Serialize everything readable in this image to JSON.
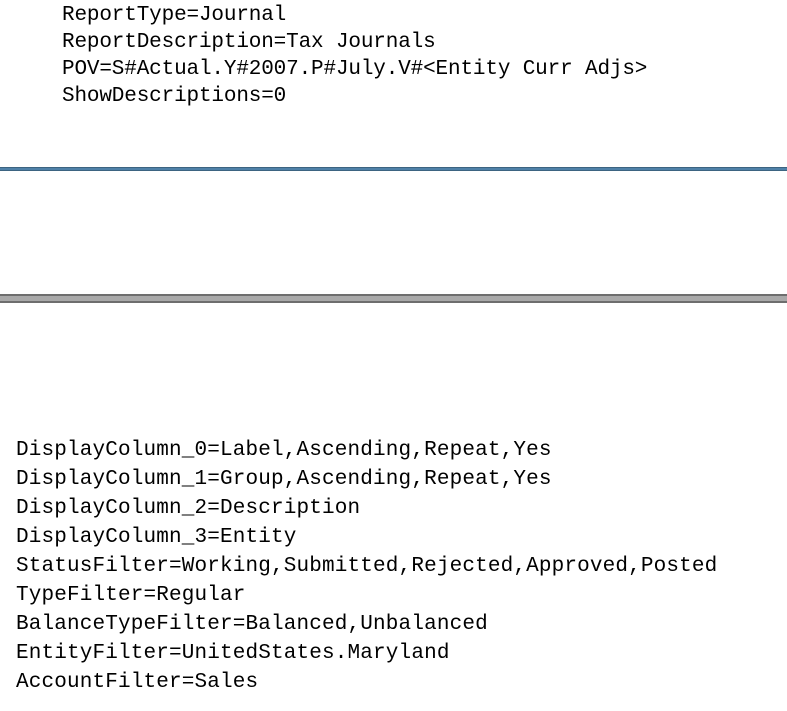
{
  "document": {
    "background_color": "#ffffff",
    "text_color": "#000000"
  },
  "upper_block": {
    "name": "report-definition-settings",
    "lines": [
      "ReportType=Journal",
      "ReportDescription=Tax Journals",
      "POV=S#Actual.Y#2007.P#July.V#<Entity Curr Adjs>",
      "ShowDescriptions=0"
    ],
    "settings": [
      {
        "key": "ReportType",
        "value": "Journal"
      },
      {
        "key": "ReportDescription",
        "value": "Tax Journals"
      },
      {
        "key": "POV",
        "value": "S#Actual.Y#2007.P#July.V#<Entity Curr Adjs>"
      },
      {
        "key": "ShowDescriptions",
        "value": "0"
      }
    ]
  },
  "divider_thin": {
    "name": "thin-blue-rule",
    "color": "#4f81a8",
    "border_color": "#3d6481"
  },
  "divider_thick": {
    "name": "thick-gray-rule",
    "color": "#a9a9a9",
    "border_color": "#6e6e6e"
  },
  "lower_block": {
    "name": "display-column-and-filter-settings",
    "lines": [
      "DisplayColumn_0=Label,Ascending,Repeat,Yes",
      "DisplayColumn_1=Group,Ascending,Repeat,Yes",
      "DisplayColumn_2=Description",
      "DisplayColumn_3=Entity",
      "StatusFilter=Working,Submitted,Rejected,Approved,Posted",
      "TypeFilter=Regular",
      "BalanceTypeFilter=Balanced,Unbalanced",
      "EntityFilter=UnitedStates.Maryland",
      "AccountFilter=Sales"
    ],
    "settings": [
      {
        "key": "DisplayColumn_0",
        "value": "Label,Ascending,Repeat,Yes"
      },
      {
        "key": "DisplayColumn_1",
        "value": "Group,Ascending,Repeat,Yes"
      },
      {
        "key": "DisplayColumn_2",
        "value": "Description"
      },
      {
        "key": "DisplayColumn_3",
        "value": "Entity"
      },
      {
        "key": "StatusFilter",
        "value": "Working,Submitted,Rejected,Approved,Posted"
      },
      {
        "key": "TypeFilter",
        "value": "Regular"
      },
      {
        "key": "BalanceTypeFilter",
        "value": "Balanced,Unbalanced"
      },
      {
        "key": "EntityFilter",
        "value": "UnitedStates.Maryland"
      },
      {
        "key": "AccountFilter",
        "value": "Sales"
      }
    ]
  }
}
